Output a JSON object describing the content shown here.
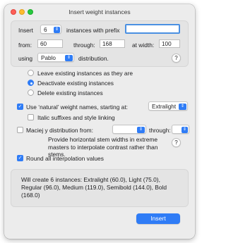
{
  "window": {
    "title": "Insert weight instances"
  },
  "instances": {
    "insert_label": "Insert",
    "count": "6",
    "prefix_label": "instances with prefix",
    "prefix_value": ""
  },
  "range": {
    "from_label": "from:",
    "from_value": "60",
    "through_label": "through:",
    "through_value": "168",
    "width_label": "at width:",
    "width_value": "100"
  },
  "distribution": {
    "using_label": "using",
    "selected": "Pablo",
    "suffix_label": "distribution."
  },
  "existing_options": {
    "selected_index": 1,
    "items": [
      {
        "label": "Leave existing instances as they are"
      },
      {
        "label": "Deactivate existing instances"
      },
      {
        "label": "Delete existing instances"
      }
    ]
  },
  "natural_names": {
    "checked": true,
    "label": "Use ‘natural’ weight names, starting at:",
    "start_value": "Extralight",
    "italic_checked": false,
    "italic_label": "Italic suffixes and style linking"
  },
  "maciej": {
    "checked": false,
    "label": "Maciej y distribution from:",
    "from_value": "",
    "through_label": "through:",
    "through_value": "",
    "description": "Provide horizontal stem widths in extreme masters to interpolate contrast rather than stems."
  },
  "round_values": {
    "checked": true,
    "label": "Round all interpolation values"
  },
  "summary": {
    "text": "Will create 6 instances:  Extralight (60.0),  Light (75.0), Regular (96.0),  Medium (119.0),  Semibold (144.0),  Bold (168.0)"
  },
  "buttons": {
    "insert": "Insert",
    "help_glyph": "?"
  },
  "colors": {
    "accent": "#2f7cf6",
    "close": "#fe5f57",
    "minimize": "#febc2e",
    "zoom": "#28c840"
  }
}
